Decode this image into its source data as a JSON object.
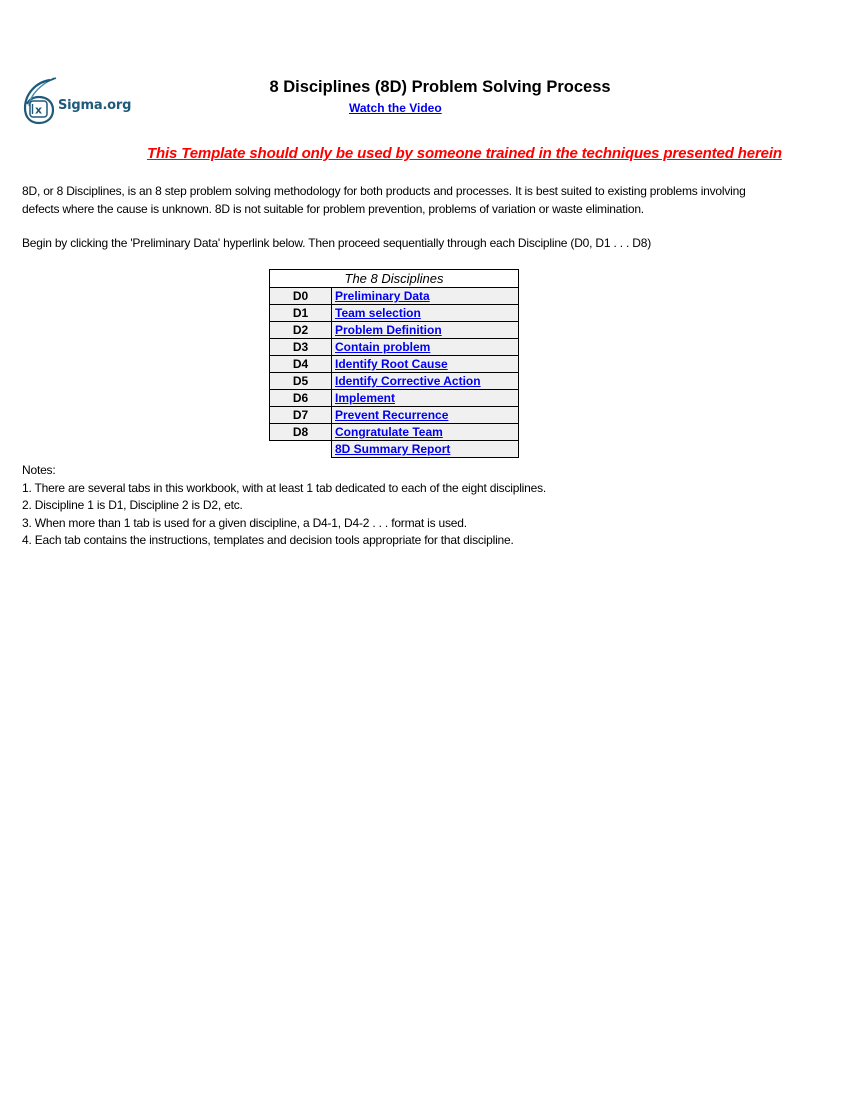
{
  "logo": {
    "text": "Sigma.org",
    "inner_glyph": "IX",
    "colors": {
      "primary": "#1f5a7a",
      "accent": "#4a8ab5"
    }
  },
  "header": {
    "title": "8 Disciplines (8D) Problem Solving Process",
    "video_link": "Watch the Video"
  },
  "warning": {
    "text": "This Template should only be used by someone trained in the techniques presented herein",
    "color": "#ff0000"
  },
  "intro": {
    "line1": "8D, or 8 Disciplines, is an 8 step problem solving methodology for both products and processes.  It is best suited to existing problems involving",
    "line2": "defects where the cause is unknown.  8D is not suitable for problem prevention, problems of variation or waste elimination.",
    "instruction": "Begin by clicking the 'Preliminary Data' hyperlink below.  Then proceed sequentially through each Discipline (D0, D1 . . . D8)"
  },
  "disciplines_table": {
    "header": "The 8 Disciplines",
    "rows": [
      {
        "code": "D0",
        "label": "Preliminary Data"
      },
      {
        "code": "D1",
        "label": "Team selection"
      },
      {
        "code": "D2",
        "label": "Problem Definition"
      },
      {
        "code": "D3",
        "label": "Contain problem"
      },
      {
        "code": "D4",
        "label": "Identify Root Cause"
      },
      {
        "code": "D5",
        "label": "Identify Corrective Action"
      },
      {
        "code": "D6",
        "label": "Implement"
      },
      {
        "code": "D7",
        "label": "Prevent Recurrence"
      },
      {
        "code": "D8",
        "label": "Congratulate Team"
      }
    ],
    "summary_link": "8D Summary Report",
    "link_color": "#0000ee",
    "row_bg": "#f0f0f0"
  },
  "notes": {
    "heading": "Notes:",
    "items": [
      "1. There are several tabs in this workbook, with at least 1 tab dedicated to each of the eight disciplines.",
      "2. Discipline 1 is D1, Discipline 2 is D2, etc.",
      "3. When more than 1 tab is used for a given discipline, a D4-1, D4-2 . . . format is used.",
      "4. Each tab contains the instructions, templates and decision tools appropriate for that discipline."
    ]
  }
}
